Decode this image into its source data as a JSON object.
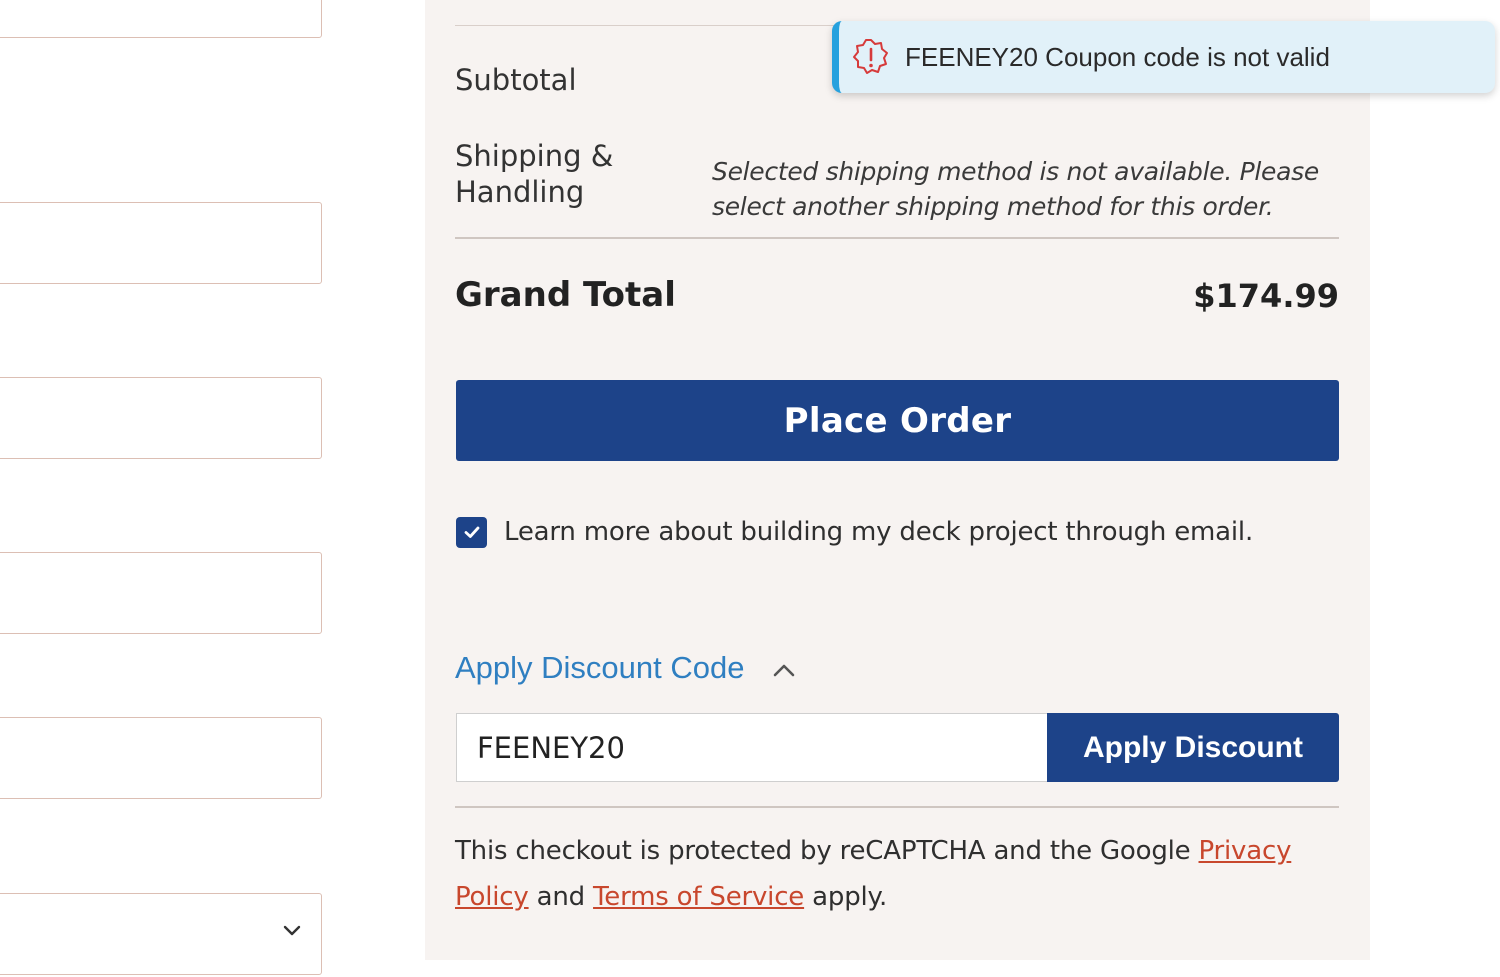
{
  "left_form": {
    "fields": [
      "",
      "",
      "",
      "",
      ""
    ],
    "select_icon": "chevron-down-icon"
  },
  "summary": {
    "subtotal_label": "Subtotal",
    "shipping_label": "Shipping & Handling",
    "shipping_note": "Selected shipping method is not available. Please select another shipping method for this order.",
    "grand_total_label": "Grand Total",
    "grand_total_value": "$174.99",
    "place_order_label": "Place Order",
    "optin_checked": true,
    "optin_label": "Learn more about building my deck project through email."
  },
  "discount": {
    "toggle_label": "Apply Discount Code",
    "toggle_icon": "chevron-up-icon",
    "input_value": "FEENEY20",
    "apply_label": "Apply Discount"
  },
  "legal": {
    "text_before": "This checkout is protected by reCAPTCHA and the Google ",
    "privacy_link": "Privacy Policy",
    "text_middle": " and ",
    "terms_link": "Terms of Service",
    "text_after": " apply."
  },
  "toast": {
    "icon": "alert-icon",
    "message": "FEENEY20 Coupon code is not valid"
  },
  "colors": {
    "brand_blue": "#1d4389",
    "link_blue": "#2f7fc1",
    "link_red": "#c8472d",
    "panel_bg": "#f7f3f1",
    "toast_bg": "#e1f1f9",
    "toast_accent": "#26a1de",
    "error_red": "#d63b3b"
  }
}
